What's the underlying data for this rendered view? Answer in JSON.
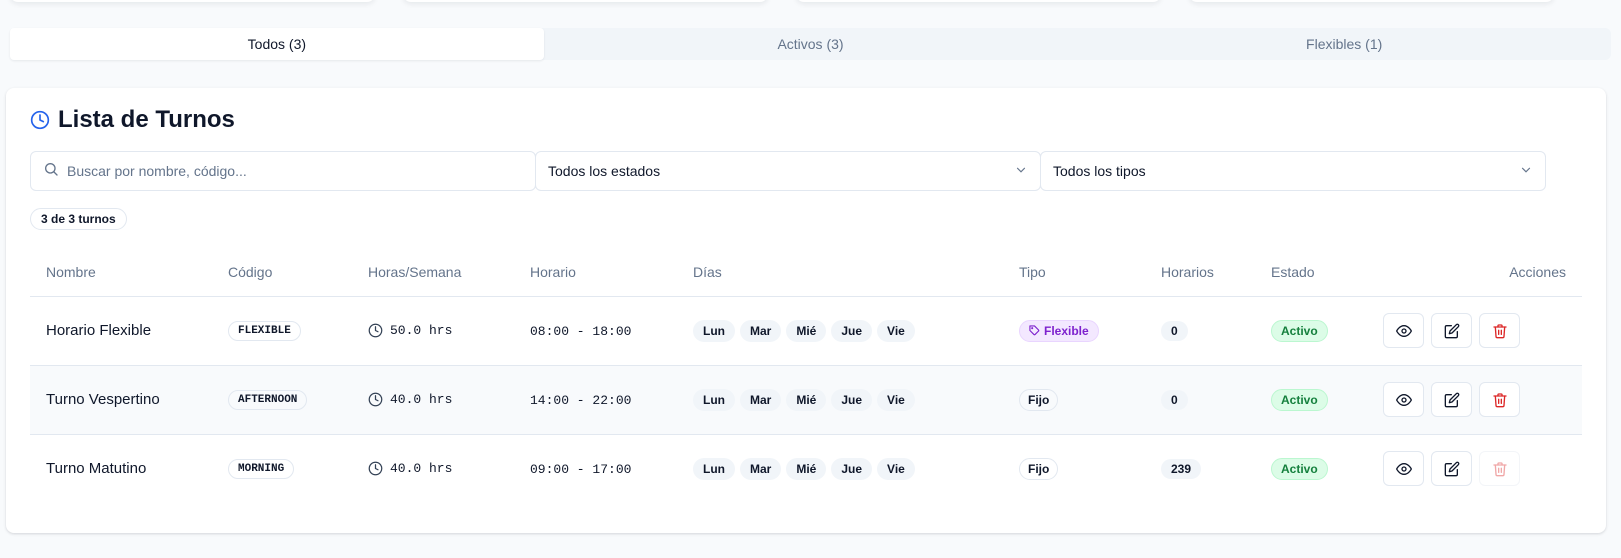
{
  "tabs": [
    {
      "label": "Todos (3)",
      "active": true
    },
    {
      "label": "Activos (3)",
      "active": false
    },
    {
      "label": "Flexibles (1)",
      "active": false
    }
  ],
  "card": {
    "title": "Lista de Turnos",
    "title_icon": "clock-icon"
  },
  "filters": {
    "search_placeholder": "Buscar por nombre, código...",
    "status_select": "Todos los estados",
    "type_select": "Todos los tipos"
  },
  "result_count": "3 de 3 turnos",
  "table": {
    "headers": [
      "Nombre",
      "Código",
      "Horas/Semana",
      "Horario",
      "Días",
      "Tipo",
      "Horarios",
      "Estado",
      "Acciones"
    ],
    "rows": [
      {
        "name": "Horario Flexible",
        "code": "FLEXIBLE",
        "hours": "50.0 hrs",
        "schedule": "08:00 - 18:00",
        "days": [
          "Lun",
          "Mar",
          "Mié",
          "Jue",
          "Vie"
        ],
        "type": "Flexible",
        "type_kind": "flexible",
        "schedules_count": "0",
        "status": "Activo",
        "delete_enabled": true
      },
      {
        "name": "Turno Vespertino",
        "code": "AFTERNOON",
        "hours": "40.0 hrs",
        "schedule": "14:00 - 22:00",
        "days": [
          "Lun",
          "Mar",
          "Mié",
          "Jue",
          "Vie"
        ],
        "type": "Fijo",
        "type_kind": "fixed",
        "schedules_count": "0",
        "status": "Activo",
        "delete_enabled": true
      },
      {
        "name": "Turno Matutino",
        "code": "MORNING",
        "hours": "40.0 hrs",
        "schedule": "09:00 - 17:00",
        "days": [
          "Lun",
          "Mar",
          "Mié",
          "Jue",
          "Vie"
        ],
        "type": "Fijo",
        "type_kind": "fixed",
        "schedules_count": "239",
        "status": "Activo",
        "delete_enabled": false
      }
    ]
  },
  "colors": {
    "accent": "#2563eb",
    "flexible_badge": "#7e22ce",
    "status_active": "#15803d",
    "delete": "#dc2626"
  }
}
